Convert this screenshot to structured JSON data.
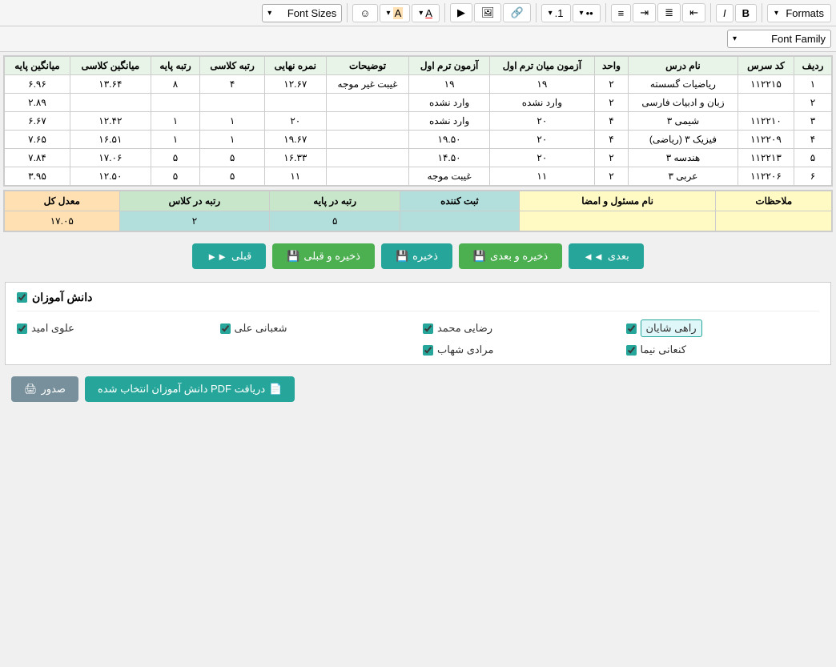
{
  "toolbar": {
    "formats_label": "Formats",
    "font_family_label": "Font Family",
    "font_sizes_label": "Font Sizes",
    "bold": "B",
    "italic": "I",
    "align_left": "≡",
    "align_center": "≡",
    "align_right": "≡",
    "align_justify": "≡",
    "list_bullet": "•",
    "list_number": "1.",
    "link": "🔗",
    "image": "🖼",
    "media": "▶",
    "font_color": "A",
    "bg_color": "A",
    "emoji": "☺"
  },
  "table": {
    "headers": [
      "ردیف",
      "کد سرس",
      "نام درس",
      "واحد",
      "آزمون میان ترم اول",
      "آزمون ترم اول",
      "توضیحات",
      "نمره نهایی",
      "رتبه کلاسی",
      "رتبه پایه",
      "میانگین کلاسی",
      "میانگین پایه"
    ],
    "rows": [
      [
        "۱",
        "۱۱۲۲۱۵",
        "ریاضیات گسسته",
        "۲",
        "۱۹",
        "۱۹",
        "غیبت غیر موجه",
        "۱۲.۶۷",
        "۴",
        "۸",
        "۱۳.۶۴",
        "۶.۹۶"
      ],
      [
        "۲",
        "",
        "زبان و ادبیات فارسی",
        "۲",
        "وارد نشده",
        "وارد نشده",
        "",
        "",
        "",
        "",
        "",
        "۲.۸۹"
      ],
      [
        "۳",
        "۱۱۲۲۱۰",
        "شیمی ۳",
        "۴",
        "۲۰",
        "وارد نشده",
        "",
        "۲۰",
        "۱",
        "۱",
        "۱۲.۴۲",
        "۶.۶۷"
      ],
      [
        "۴",
        "۱۱۲۲۰۹",
        "فیزیک ۳ (ریاضی)",
        "۴",
        "۲۰",
        "۱۹.۵۰",
        "",
        "۱۹.۶۷",
        "۱",
        "۱",
        "۱۶.۵۱",
        "۷.۶۵"
      ],
      [
        "۵",
        "۱۱۲۲۱۳",
        "هندسه ۳",
        "۲",
        "۲۰",
        "۱۴.۵۰",
        "",
        "۱۶.۳۳",
        "۵",
        "۵",
        "۱۷.۰۶",
        "۷.۸۴"
      ],
      [
        "۶",
        "۱۱۲۲۰۶",
        "عربی ۳",
        "۲",
        "۱۱",
        "غیبت موجه",
        "",
        "۱۱",
        "۵",
        "۵",
        "۱۲.۵۰",
        "۳.۹۵"
      ]
    ]
  },
  "summary": {
    "headers": [
      "معدل کل",
      "رتبه در کلاس",
      "رتبه در پایه",
      "ثبت کننده",
      "نام مسئول و امضا",
      "ملاحظات"
    ],
    "data": [
      "۱۷.۰۵",
      "۲",
      "۵",
      "",
      "",
      ""
    ]
  },
  "buttons": {
    "prev": "قبلی",
    "save_prev": "ذخیره و قبلی",
    "save": "ذخیره",
    "save_next": "ذخیره و بعدی",
    "next": "بعدی"
  },
  "students_section": {
    "title": "دانش آموزان",
    "students": [
      {
        "name": "راهی شایان",
        "selected": true
      },
      {
        "name": "رضایی محمد",
        "selected": true
      },
      {
        "name": "شعبانی علی",
        "selected": true
      },
      {
        "name": "علوی امید",
        "selected": true
      },
      {
        "name": "کنعانی نیما",
        "selected": true
      },
      {
        "name": "مرادی شهاب",
        "selected": true
      }
    ]
  },
  "bottom_buttons": {
    "pdf_label": "دریافت PDF دانش آموزان انتخاب شده",
    "print_label": "صدور"
  },
  "icons": {
    "chevron_down": "▾",
    "save_icon": "💾",
    "arrow_left": "◄",
    "arrow_right": "►",
    "double_arrow_left": "◄◄",
    "double_arrow_right": "►►",
    "checkbox_checked": "✓",
    "pdf_icon": "📄",
    "print_icon": "🖨"
  }
}
